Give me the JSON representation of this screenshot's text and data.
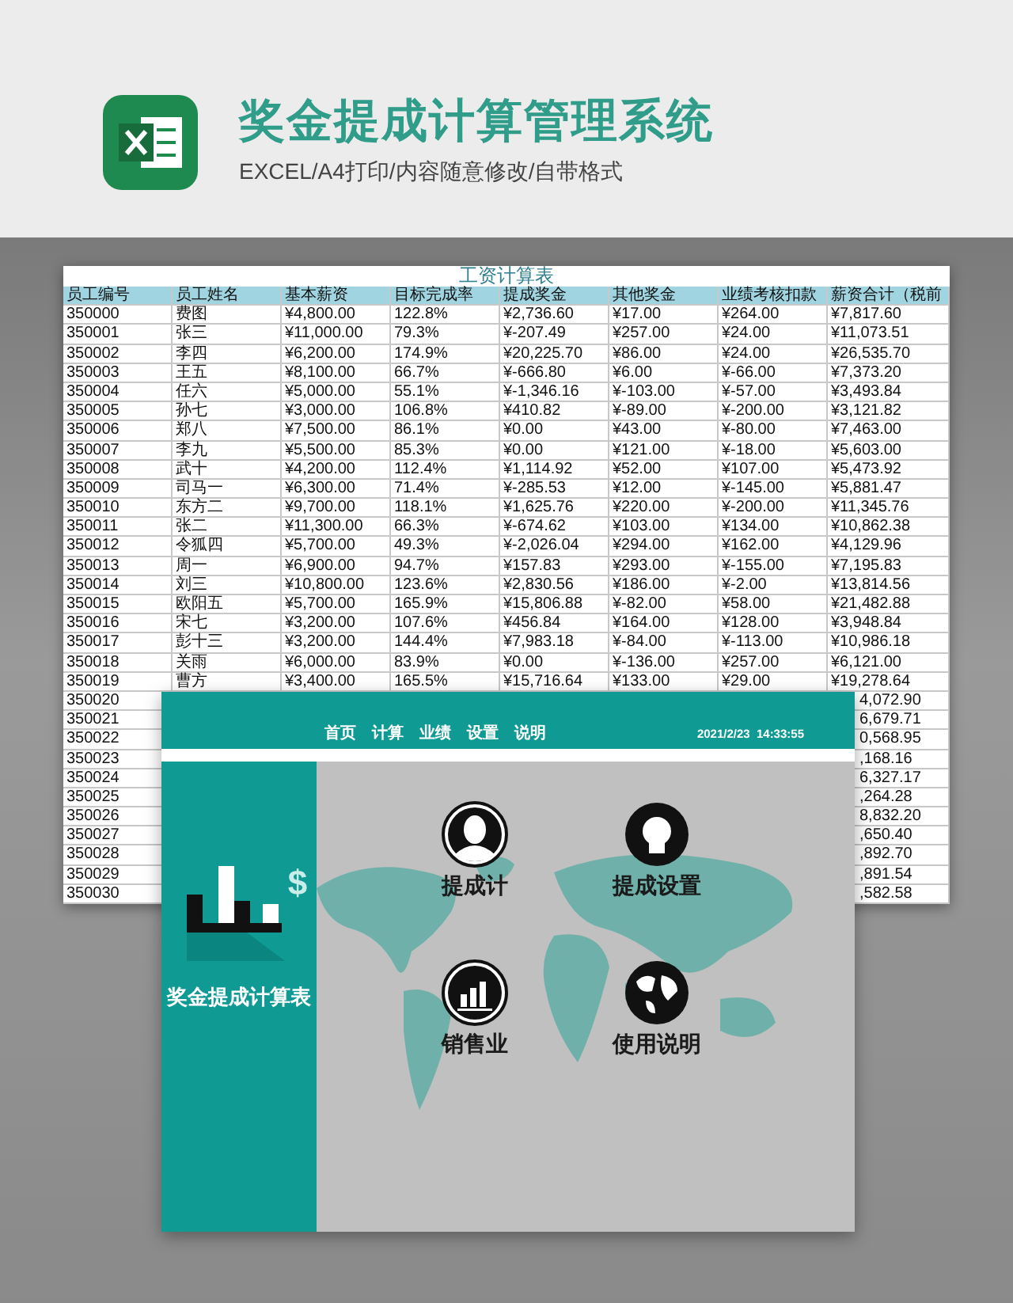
{
  "header": {
    "title": "奖金提成计算管理系统",
    "subtitle": "EXCEL/A4打印/内容随意修改/自带格式"
  },
  "sheet": {
    "title": "工资计算表",
    "columns": [
      "员工编号",
      "员工姓名",
      "基本薪资",
      "目标完成率",
      "提成奖金",
      "其他奖金",
      "业绩考核扣款",
      "薪资合计（税前"
    ],
    "rows": [
      [
        "350000",
        "费图",
        "¥4,800.00",
        "122.8%",
        "¥2,736.60",
        "¥17.00",
        "¥264.00",
        "¥7,817.60"
      ],
      [
        "350001",
        "张三",
        "¥11,000.00",
        "79.3%",
        "¥-207.49",
        "¥257.00",
        "¥24.00",
        "¥11,073.51"
      ],
      [
        "350002",
        "李四",
        "¥6,200.00",
        "174.9%",
        "¥20,225.70",
        "¥86.00",
        "¥24.00",
        "¥26,535.70"
      ],
      [
        "350003",
        "王五",
        "¥8,100.00",
        "66.7%",
        "¥-666.80",
        "¥6.00",
        "¥-66.00",
        "¥7,373.20"
      ],
      [
        "350004",
        "任六",
        "¥5,000.00",
        "55.1%",
        "¥-1,346.16",
        "¥-103.00",
        "¥-57.00",
        "¥3,493.84"
      ],
      [
        "350005",
        "孙七",
        "¥3,000.00",
        "106.8%",
        "¥410.82",
        "¥-89.00",
        "¥-200.00",
        "¥3,121.82"
      ],
      [
        "350006",
        "郑八",
        "¥7,500.00",
        "86.1%",
        "¥0.00",
        "¥43.00",
        "¥-80.00",
        "¥7,463.00"
      ],
      [
        "350007",
        "李九",
        "¥5,500.00",
        "85.3%",
        "¥0.00",
        "¥121.00",
        "¥-18.00",
        "¥5,603.00"
      ],
      [
        "350008",
        "武十",
        "¥4,200.00",
        "112.4%",
        "¥1,114.92",
        "¥52.00",
        "¥107.00",
        "¥5,473.92"
      ],
      [
        "350009",
        "司马一",
        "¥6,300.00",
        "71.4%",
        "¥-285.53",
        "¥12.00",
        "¥-145.00",
        "¥5,881.47"
      ],
      [
        "350010",
        "东方二",
        "¥9,700.00",
        "118.1%",
        "¥1,625.76",
        "¥220.00",
        "¥-200.00",
        "¥11,345.76"
      ],
      [
        "350011",
        "张二",
        "¥11,300.00",
        "66.3%",
        "¥-674.62",
        "¥103.00",
        "¥134.00",
        "¥10,862.38"
      ],
      [
        "350012",
        "令狐四",
        "¥5,700.00",
        "49.3%",
        "¥-2,026.04",
        "¥294.00",
        "¥162.00",
        "¥4,129.96"
      ],
      [
        "350013",
        "周一",
        "¥6,900.00",
        "94.7%",
        "¥157.83",
        "¥293.00",
        "¥-155.00",
        "¥7,195.83"
      ],
      [
        "350014",
        "刘三",
        "¥10,800.00",
        "123.6%",
        "¥2,830.56",
        "¥186.00",
        "¥-2.00",
        "¥13,814.56"
      ],
      [
        "350015",
        "欧阳五",
        "¥5,700.00",
        "165.9%",
        "¥15,806.88",
        "¥-82.00",
        "¥58.00",
        "¥21,482.88"
      ],
      [
        "350016",
        "宋七",
        "¥3,200.00",
        "107.6%",
        "¥456.84",
        "¥164.00",
        "¥128.00",
        "¥3,948.84"
      ],
      [
        "350017",
        "彭十三",
        "¥3,200.00",
        "144.4%",
        "¥7,983.18",
        "¥-84.00",
        "¥-113.00",
        "¥10,986.18"
      ],
      [
        "350018",
        "关雨",
        "¥6,000.00",
        "83.9%",
        "¥0.00",
        "¥-136.00",
        "¥257.00",
        "¥6,121.00"
      ],
      [
        "350019",
        "曹方",
        "¥3,400.00",
        "165.5%",
        "¥15,716.64",
        "¥133.00",
        "¥29.00",
        "¥19,278.64"
      ]
    ],
    "covered_rows": [
      {
        "employee_id": "350020",
        "total_visible": "4,072.90"
      },
      {
        "employee_id": "350021",
        "total_visible": "6,679.71"
      },
      {
        "employee_id": "350022",
        "total_visible": "0,568.95"
      },
      {
        "employee_id": "350023",
        "total_visible": ",168.16"
      },
      {
        "employee_id": "350024",
        "total_visible": "6,327.17"
      },
      {
        "employee_id": "350025",
        "total_visible": ",264.28"
      },
      {
        "employee_id": "350026",
        "total_visible": "8,832.20"
      },
      {
        "employee_id": "350027",
        "total_visible": ",650.40"
      },
      {
        "employee_id": "350028",
        "total_visible": ",892.70"
      },
      {
        "employee_id": "350029",
        "total_visible": ",891.54"
      },
      {
        "employee_id": "350030",
        "total_visible": ",582.58"
      }
    ]
  },
  "app": {
    "nav": [
      "首页",
      "计算",
      "业绩",
      "设置",
      "说明"
    ],
    "datetime": "2021/2/23  14:33:55",
    "sidebar_symbol": "$",
    "sidebar_title": "奖金提成计算表",
    "tiles": [
      {
        "kind": "person",
        "label": "提成计"
      },
      {
        "kind": "bulb",
        "label": "提成设置"
      },
      {
        "kind": "chart",
        "label": "销售业"
      },
      {
        "kind": "globe",
        "label": "使用说明"
      }
    ]
  }
}
